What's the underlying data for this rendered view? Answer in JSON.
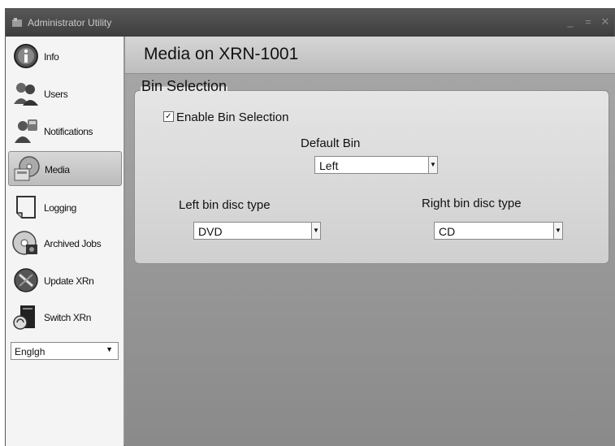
{
  "window": {
    "title": "Administrator Utility"
  },
  "sidebar": {
    "items": [
      {
        "label": "Info",
        "icon": "info-icon"
      },
      {
        "label": "Users",
        "icon": "users-icon"
      },
      {
        "label": "Notifications",
        "icon": "notifications-icon"
      },
      {
        "label": "Media",
        "icon": "media-icon",
        "active": true
      },
      {
        "label": "Logging",
        "icon": "logging-icon"
      },
      {
        "label": "Archived Jobs",
        "icon": "archived-jobs-icon"
      },
      {
        "label": "Update XRn",
        "icon": "update-icon"
      },
      {
        "label": "Switch XRn",
        "icon": "switch-icon"
      }
    ],
    "language": "Englgh"
  },
  "main": {
    "title": "Media on XRN-1001",
    "group": {
      "legend": "Bin Selection",
      "enable_label": "Enable Bin Selection",
      "enable_checked": true,
      "default_bin_label": "Default Bin",
      "default_bin_value": "Left",
      "left_disc_label": "Left bin disc type",
      "left_disc_value": "DVD",
      "right_disc_label": "Right bin disc type",
      "right_disc_value": "CD"
    }
  },
  "colors": {
    "active_item": "#c8c8c8",
    "content_bg": "#999999",
    "titlebar": "#4a4a4a"
  }
}
